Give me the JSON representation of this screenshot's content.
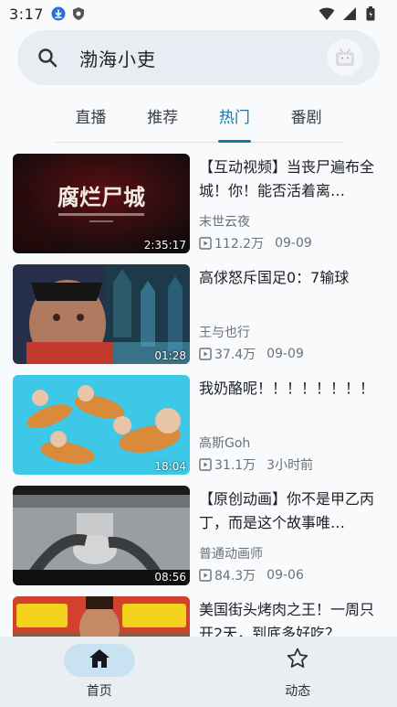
{
  "status_bar": {
    "time": "3:17"
  },
  "search": {
    "query": "渤海小吏"
  },
  "tabs": [
    {
      "label": "直播"
    },
    {
      "label": "推荐"
    },
    {
      "label": "热门"
    },
    {
      "label": "番剧"
    }
  ],
  "videos": [
    {
      "title": "【互动视频】当丧尸遍布全城！你！能否活着离…",
      "author": "末世云夜",
      "views": "112.2万",
      "date": "09-09",
      "duration": "2:35:17",
      "thumb_text": "腐烂尸城"
    },
    {
      "title": "高俅怒斥国足0：7输球",
      "author": "王与也行",
      "views": "37.4万",
      "date": "09-09",
      "duration": "01:28"
    },
    {
      "title": "我奶酪呢！！！！！！！！",
      "author": "高斯Goh",
      "views": "31.1万",
      "date": "3小时前",
      "duration": "18:04"
    },
    {
      "title": "【原创动画】你不是甲乙丙丁，而是这个故事唯…",
      "author": "普通动画师",
      "views": "84.3万",
      "date": "09-06",
      "duration": "08:56"
    },
    {
      "title": "美国街头烤肉之王！一周只开2天，到底多好吃？",
      "author": "",
      "views": "",
      "date": "",
      "duration": ""
    }
  ],
  "bottom_nav": [
    {
      "label": "首页",
      "icon": "home-icon"
    },
    {
      "label": "动态",
      "icon": "star-icon"
    }
  ],
  "colors": {
    "accent": "#1478a8",
    "nav_pill": "#c9e2f1",
    "search_bg": "#e7edf2"
  }
}
